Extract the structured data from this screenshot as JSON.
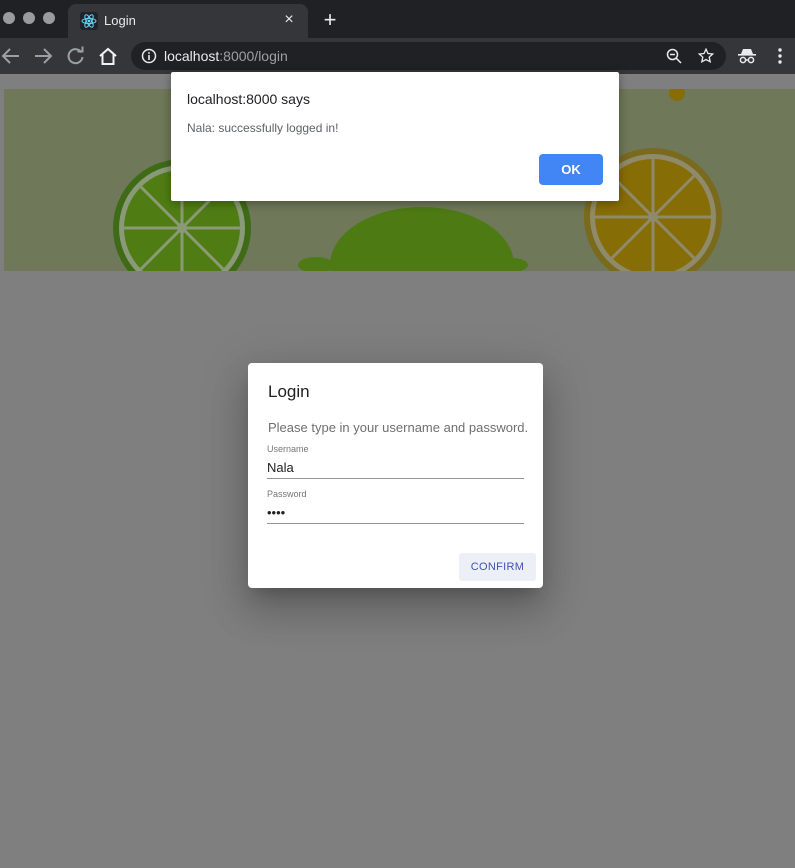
{
  "browser": {
    "tab_title": "Login",
    "tab_close": "×",
    "new_tab": "+",
    "url_host": "localhost",
    "url_rest": ":8000/login",
    "icons": [
      "react-favicon-icon",
      "back-arrow-icon",
      "forward-arrow-icon",
      "reload-icon",
      "home-icon",
      "info-icon",
      "zoom-icon",
      "bookmark-star-icon",
      "incognito-icon",
      "menu-dots-icon"
    ]
  },
  "alert": {
    "title": "localhost:8000 says",
    "message": "Nala: successfully logged in!",
    "ok_label": "OK",
    "button_color": "#4285f4"
  },
  "login": {
    "title": "Login",
    "prompt": "Please type in your username and password.",
    "username_label": "Username",
    "username_value": "Nala",
    "password_label": "Password",
    "password_value": "••••",
    "confirm_label": "CONFIRM",
    "confirm_color": "#3f51b5"
  },
  "banner": {
    "illustration": [
      "lime-slice",
      "whole-lime",
      "lemon-slice",
      "lemon-drop"
    ]
  }
}
